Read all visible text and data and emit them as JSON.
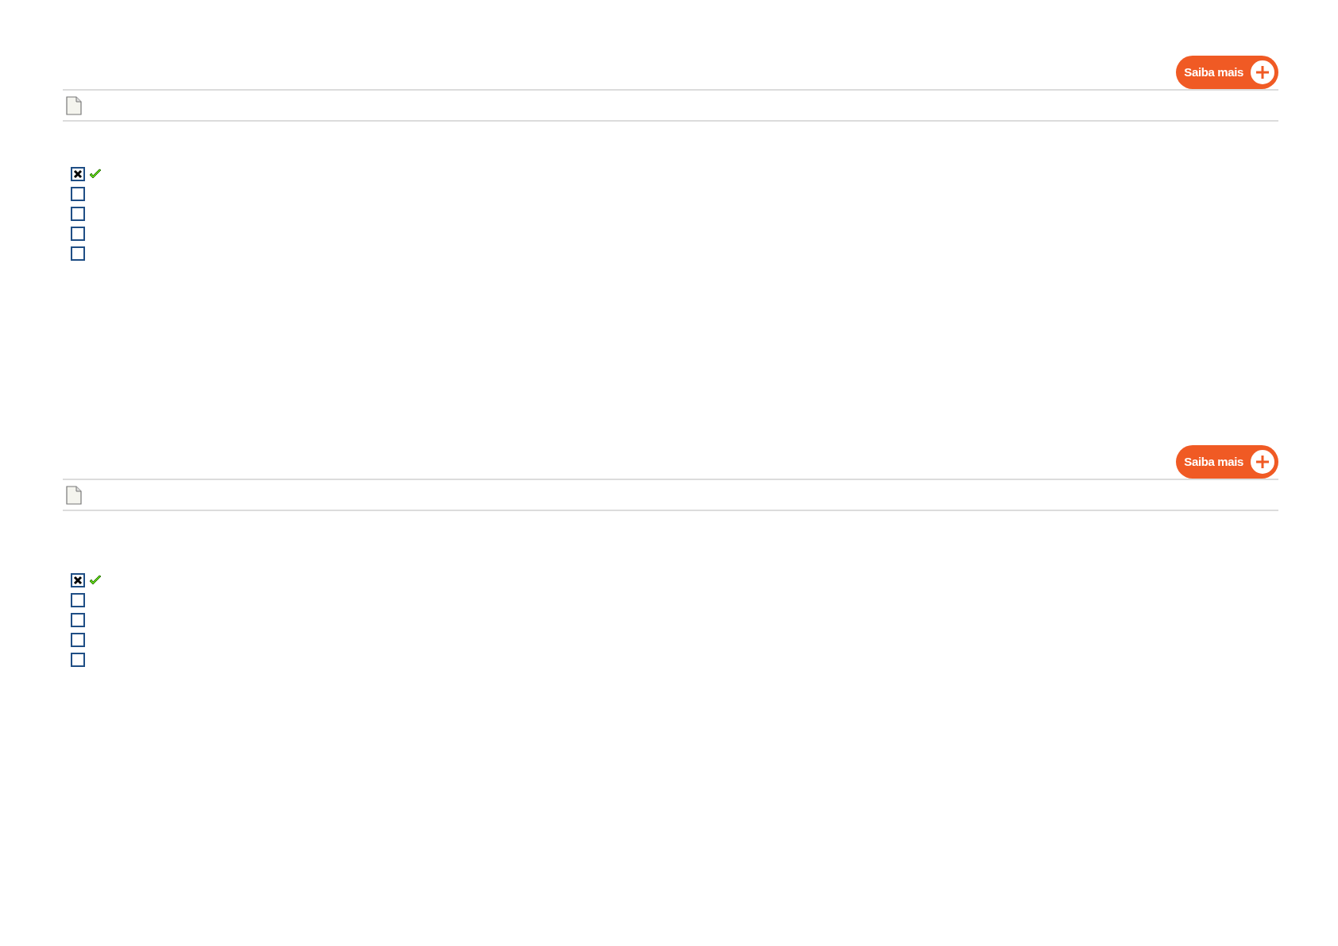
{
  "sections": [
    {
      "button": "Saiba mais",
      "options": [
        {
          "checked": true,
          "correct": true
        },
        {
          "checked": false,
          "correct": false
        },
        {
          "checked": false,
          "correct": false
        },
        {
          "checked": false,
          "correct": false
        },
        {
          "checked": false,
          "correct": false
        }
      ]
    },
    {
      "button": "Saiba mais",
      "options": [
        {
          "checked": true,
          "correct": true
        },
        {
          "checked": false,
          "correct": false
        },
        {
          "checked": false,
          "correct": false
        },
        {
          "checked": false,
          "correct": false
        },
        {
          "checked": false,
          "correct": false
        }
      ]
    }
  ]
}
